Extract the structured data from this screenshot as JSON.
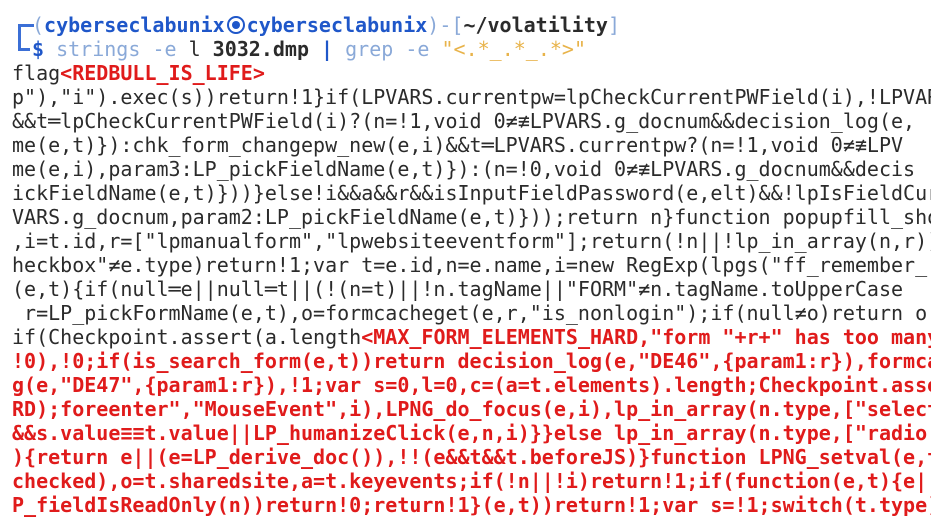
{
  "prompt": {
    "open_paren": "(",
    "user": "cyberseclabunix",
    "host": "cyberseclabunix",
    "close_paren": ")",
    "dash_bracket_open": "-[",
    "path": "~/volatility",
    "bracket_close": "]",
    "dollar": "$",
    "cmd": "strings",
    "flag_e": "-e",
    "flag_l": "l",
    "file": "3032.dmp",
    "pipe": "|",
    "grep": "grep",
    "grep_flag": "-e",
    "pattern": "\"<.*_.*_.*>\""
  },
  "output": {
    "flag_prefix": "flag",
    "flag_value": "<REDBULL_IS_LIFE>",
    "plain_lines": [
      "p\"),\"i\").exec(s))return!1}if(LPVARS.currentpw=lpCheckCurrentPWField(i),!LPVAR",
      "&&t═lpCheckCurrentPWField(i)?(n=!1,void 0≠≢LPVARS.g_docnum&&decision_log(e,",
      "me(e,t)}):chk_form_changepw_new(e,i)&&t═LPVARS.currentpw?(n=!1,void 0≠≢LPV",
      "me(e,i),param3:LP_pickFieldName(e,t)}):(n=!0,void 0≠≢LPVARS.g_docnum&&decis",
      "ickFieldName(e,t)}))}else!i&&a&&r&&isInputFieldPassword(e,elt)&&!lpIsFieldCur",
      "VARS.g_docnum,param2:LP_pickFieldName(e,t)}));return n}function popupfill_sho",
      ",i=t.id,r=[\"lpmanualform\",\"lpwebsiteeventform\"];return(!n||!lp_in_array(n,r))",
      "heckbox\"≠e.type)return!1;var t=e.id,n=e.name,i=new RegExp(lpgs(\"ff_remember_",
      "(e,t){if(null═e||null═t||(!(n=t)||!n.tagName||\"FORM\"≠n.tagName.toUpperCase",
      " r=LP_pickFormName(e,t),o=formcacheget(e,r,\"is_nonlogin\");if(null≠o)return o"
    ],
    "mixed_line_plain": "if(Checkpoint.assert(a.length",
    "mixed_line_red": "<MAX_FORM_ELEMENTS_HARD,\"form \"+r+\" has too many",
    "red_lines": [
      "!0),!0;if(is_search_form(e,t))return decision_log(e,\"DE46\",{param1:r}),formca",
      "g(e,\"DE47\",{param1:r}),!1;var s=0,l=0,c=(a=t.elements).length;Checkpoint.asse",
      "RD);foreenter\",\"MouseEvent\",i),LPNG_do_focus(e,i),lp_in_array(n.type,[\"select",
      "&&s.value≡≡t.value||LP_humanizeClick(e,n,i)}}else lp_in_array(n.type,[\"radio",
      "){return e||(e=LP_derive_doc()),!!(e&&t&&t.beforeJS)}function LPNG_setval(e,t",
      "checked),o=t.sharedsite,a=t.keyevents;if(!n||!i)return!1;if(function(e,t){e||",
      "P_fieldIsReadOnly(n))return!0;return!1}(e,t))return!1;var s=!1;switch(t.type)"
    ]
  }
}
